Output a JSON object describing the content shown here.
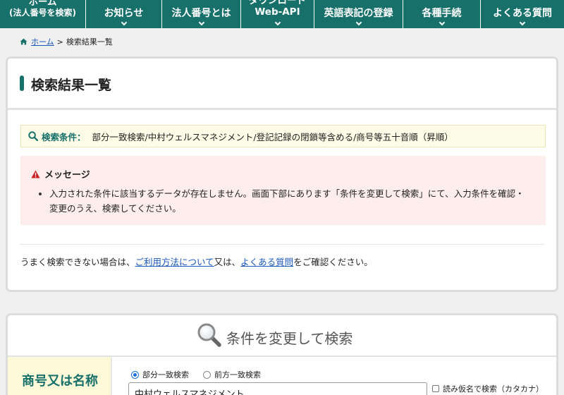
{
  "nav": {
    "items": [
      {
        "line1": "ホーム",
        "line2": "(法人番号を検索)"
      },
      {
        "label": "お知らせ"
      },
      {
        "label": "法人番号とは"
      },
      {
        "line1": "ダウンロード",
        "line2": "Web-API"
      },
      {
        "label": "英語表記の登録"
      },
      {
        "label": "各種手続"
      },
      {
        "label": "よくある質問"
      }
    ]
  },
  "breadcrumb": {
    "home": "ホーム",
    "separator": ">",
    "current": "検索結果一覧"
  },
  "results": {
    "title": "検索結果一覧",
    "condition_label": "検索条件：",
    "condition_value": "部分一致検索/中村ウェルスマネジメント/登記記録の閉鎖等含める/商号等五十音順（昇順）",
    "message_title": "メッセージ",
    "message_text": "入力された条件に該当するデータが存在しません。画面下部にあります「条件を変更して検索」にて、入力条件を確認・変更のうえ、検索してください。",
    "help_prefix": "うまく検索できない場合は、",
    "help_link1": "ご利用方法について",
    "help_mid": "又は、",
    "help_link2": "よくある質問",
    "help_suffix": "をご確認ください。"
  },
  "change_search": {
    "title": "条件を変更して検索",
    "field_label": "商号又は名称",
    "radio_partial": "部分一致検索",
    "radio_prefix": "前方一致検索",
    "name_value": "中村ウェルスマネジメント",
    "kana_label": "読み仮名で検索（カタカナ）"
  },
  "colors": {
    "brand": "#17706a",
    "link": "#1a56b8",
    "message_bg": "#fdeeed",
    "condition_bg": "#fdfce6"
  }
}
